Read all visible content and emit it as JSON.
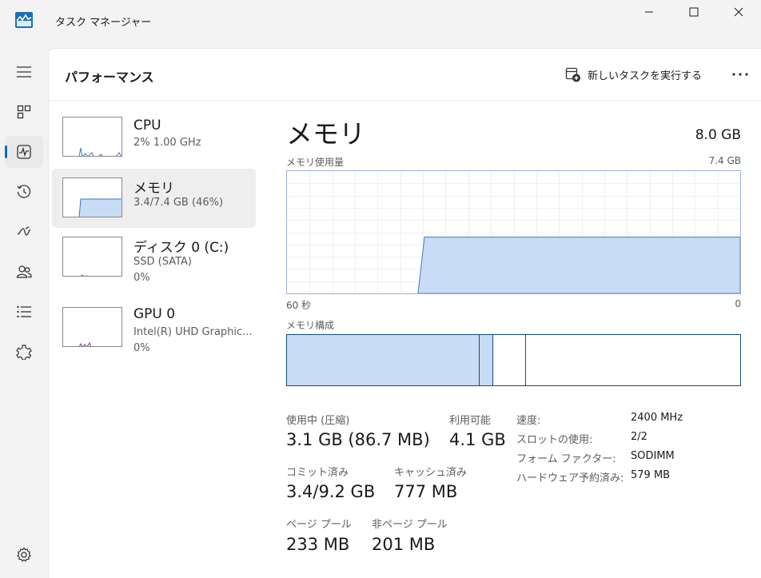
{
  "window": {
    "title": "タスク マネージャー",
    "controls": [
      "minimize",
      "maximize",
      "close"
    ]
  },
  "nav": {
    "items": [
      {
        "name": "hamburger-menu-icon"
      },
      {
        "name": "processes-icon"
      },
      {
        "name": "performance-icon",
        "active": true
      },
      {
        "name": "app-history-icon"
      },
      {
        "name": "startup-apps-icon"
      },
      {
        "name": "users-icon"
      },
      {
        "name": "details-icon"
      },
      {
        "name": "services-icon"
      }
    ],
    "settings": "settings-icon"
  },
  "header": {
    "title": "パフォーマンス",
    "run_task_label": "新しいタスクを実行する",
    "more_icon": "more-icon"
  },
  "devices": [
    {
      "name": "CPU",
      "line1": "2%  1.00 GHz",
      "line2": ""
    },
    {
      "name": "メモリ",
      "line1": "3.4/7.4 GB (46%)",
      "line2": "",
      "selected": true
    },
    {
      "name": "ディスク 0 (C:)",
      "line1": "SSD (SATA)",
      "line2": "0%"
    },
    {
      "name": "GPU 0",
      "line1": "Intel(R) UHD Graphic...",
      "line2": "0%"
    }
  ],
  "detail": {
    "title": "メモリ",
    "total": "8.0 GB",
    "usage_label": "メモリ使用量",
    "usage_max": "7.4 GB",
    "axis_left": "60 秒",
    "axis_right": "0",
    "composition_label": "メモリ構成",
    "usage_level_fraction": 0.46,
    "stats": {
      "in_use_label": "使用中 (圧縮)",
      "in_use_value": "3.1 GB (86.7 MB)",
      "available_label": "利用可能",
      "available_value": "4.1 GB",
      "committed_label": "コミット済み",
      "committed_value": "3.4/9.2 GB",
      "cached_label": "キャッシュ済み",
      "cached_value": "777 MB",
      "paged_label": "ページ プール",
      "paged_value": "233 MB",
      "nonpaged_label": "非ページ プール",
      "nonpaged_value": "201 MB"
    },
    "props": {
      "speed_label": "速度:",
      "speed_value": "2400 MHz",
      "slots_label": "スロットの使用:",
      "slots_value": "2/2",
      "form_label": "フォーム ファクター:",
      "form_value": "SODIMM",
      "reserved_label": "ハードウェア予約済み:",
      "reserved_value": "579 MB"
    }
  },
  "colors": {
    "memory_fill": "#c9dcf5",
    "memory_border": "#3a78c4",
    "accent": "#0f6cbd"
  }
}
